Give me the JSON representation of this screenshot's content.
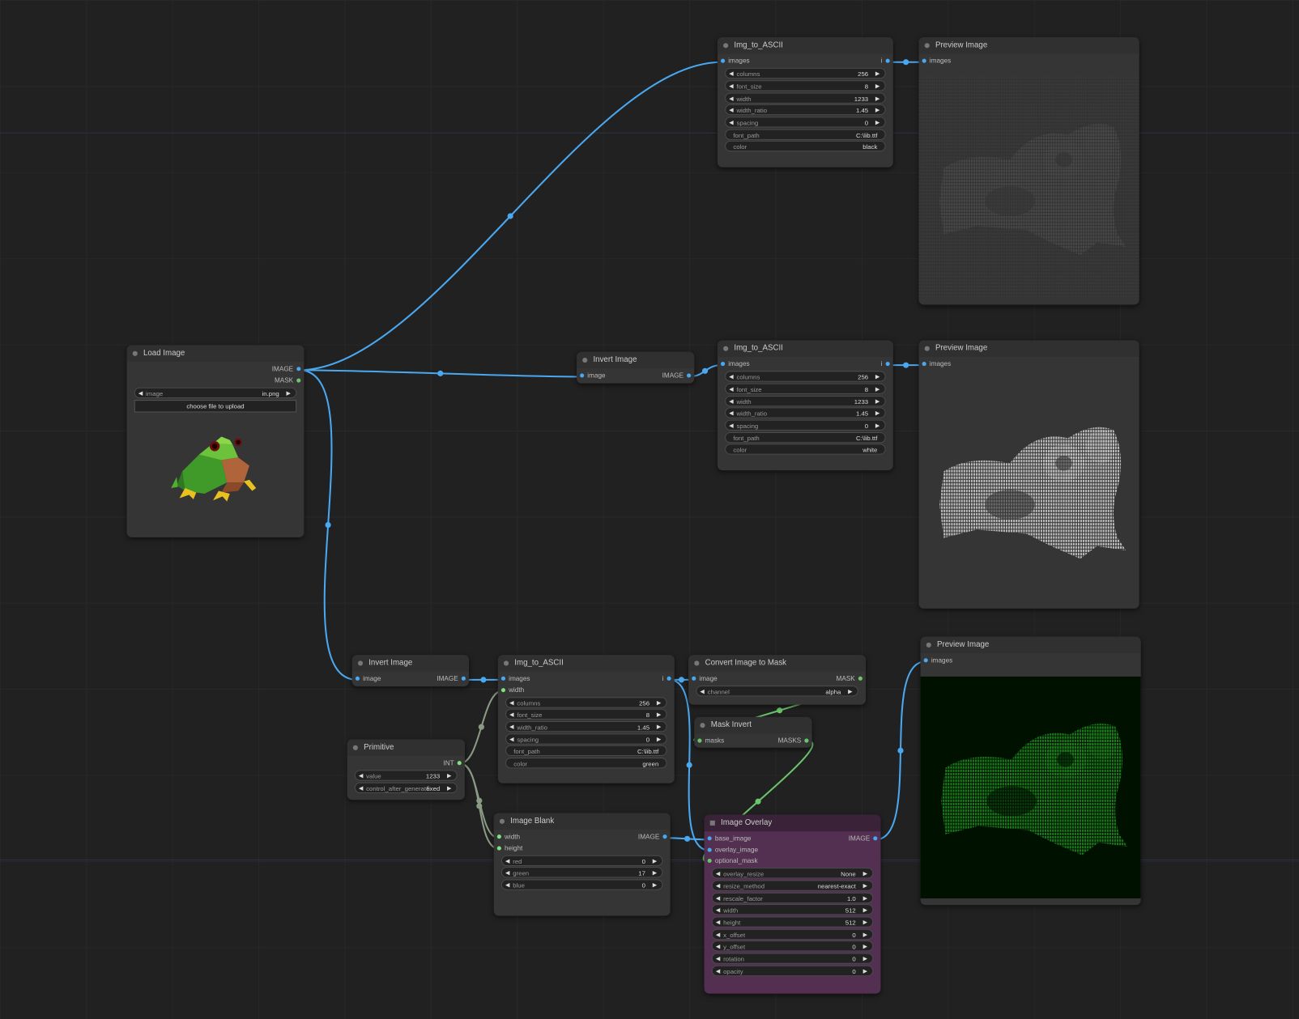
{
  "nodes": [
    {
      "id": "ascii1",
      "title": "Img_to_ASCII",
      "inputs": [
        {
          "label": "images",
          "color": "#4aa8f0"
        }
      ],
      "outputs": [
        {
          "label": "i",
          "color": "#4aa8f0"
        }
      ],
      "widgets": [
        {
          "label": "columns",
          "value": "256",
          "arrows": true
        },
        {
          "label": "font_size",
          "value": "8",
          "arrows": true
        },
        {
          "label": "width",
          "value": "1233",
          "arrows": true
        },
        {
          "label": "width_ratio",
          "value": "1.45",
          "arrows": true
        },
        {
          "label": "spacing",
          "value": "0",
          "arrows": true
        },
        {
          "label": "font_path",
          "value": "C:\\lib.ttf",
          "arrows": false
        },
        {
          "label": "color",
          "value": "black",
          "arrows": false
        }
      ]
    },
    {
      "id": "preview1",
      "title": "Preview Image",
      "inputs": [
        {
          "label": "images",
          "color": "#4aa8f0"
        }
      ],
      "outputs": [],
      "widgets": [],
      "preview": "black"
    },
    {
      "id": "load",
      "title": "Load Image",
      "inputs": [],
      "outputs": [
        {
          "label": "IMAGE",
          "color": "#4aa8f0"
        },
        {
          "label": "MASK",
          "color": "#6cc46c"
        }
      ],
      "widgets": [
        {
          "label": "image",
          "value": "in.png",
          "arrows": true
        }
      ],
      "button": "choose file to upload",
      "preview": "frog"
    },
    {
      "id": "invert1",
      "title": "Invert Image",
      "inputs": [
        {
          "label": "image",
          "color": "#4aa8f0"
        }
      ],
      "outputs": [
        {
          "label": "IMAGE",
          "color": "#4aa8f0"
        }
      ],
      "widgets": []
    },
    {
      "id": "ascii2",
      "title": "Img_to_ASCII",
      "inputs": [
        {
          "label": "images",
          "color": "#4aa8f0"
        }
      ],
      "outputs": [
        {
          "label": "i",
          "color": "#4aa8f0"
        }
      ],
      "widgets": [
        {
          "label": "columns",
          "value": "256",
          "arrows": true
        },
        {
          "label": "font_size",
          "value": "8",
          "arrows": true
        },
        {
          "label": "width",
          "value": "1233",
          "arrows": true
        },
        {
          "label": "width_ratio",
          "value": "1.45",
          "arrows": true
        },
        {
          "label": "spacing",
          "value": "0",
          "arrows": true
        },
        {
          "label": "font_path",
          "value": "C:\\lib.ttf",
          "arrows": false
        },
        {
          "label": "color",
          "value": "white",
          "arrows": false
        }
      ]
    },
    {
      "id": "preview2",
      "title": "Preview Image",
      "inputs": [
        {
          "label": "images",
          "color": "#4aa8f0"
        }
      ],
      "outputs": [],
      "widgets": [],
      "preview": "white"
    },
    {
      "id": "invert2",
      "title": "Invert Image",
      "inputs": [
        {
          "label": "image",
          "color": "#4aa8f0"
        }
      ],
      "outputs": [
        {
          "label": "IMAGE",
          "color": "#4aa8f0"
        }
      ],
      "widgets": []
    },
    {
      "id": "ascii3",
      "title": "Img_to_ASCII",
      "inputs": [
        {
          "label": "images",
          "color": "#4aa8f0"
        },
        {
          "label": "width",
          "color": "#7ee07e"
        }
      ],
      "outputs": [
        {
          "label": "i",
          "color": "#4aa8f0"
        }
      ],
      "widgets": [
        {
          "label": "columns",
          "value": "256",
          "arrows": true
        },
        {
          "label": "font_size",
          "value": "8",
          "arrows": true
        },
        {
          "label": "width_ratio",
          "value": "1.45",
          "arrows": true
        },
        {
          "label": "spacing",
          "value": "0",
          "arrows": true
        },
        {
          "label": "font_path",
          "value": "C:\\lib.ttf",
          "arrows": false
        },
        {
          "label": "color",
          "value": "green",
          "arrows": false
        }
      ]
    },
    {
      "id": "convmask",
      "title": "Convert Image to Mask",
      "inputs": [
        {
          "label": "image",
          "color": "#4aa8f0"
        }
      ],
      "outputs": [
        {
          "label": "MASK",
          "color": "#6cc46c"
        }
      ],
      "widgets": [
        {
          "label": "channel",
          "value": "alpha",
          "arrows": true
        }
      ]
    },
    {
      "id": "maskinv",
      "title": "Mask Invert",
      "inputs": [
        {
          "label": "masks",
          "color": "#6cc46c"
        }
      ],
      "outputs": [
        {
          "label": "MASKS",
          "color": "#6cc46c"
        }
      ],
      "widgets": []
    },
    {
      "id": "primitive",
      "title": "Primitive",
      "inputs": [],
      "outputs": [
        {
          "label": "INT",
          "color": "#7ee07e"
        }
      ],
      "widgets": [
        {
          "label": "value",
          "value": "1233",
          "arrows": true
        },
        {
          "label": "control_after_generate",
          "value": "fixed",
          "arrows": true
        }
      ]
    },
    {
      "id": "blank",
      "title": "Image Blank",
      "inputs": [
        {
          "label": "width",
          "color": "#7ee07e"
        },
        {
          "label": "height",
          "color": "#7ee07e"
        }
      ],
      "outputs": [
        {
          "label": "IMAGE",
          "color": "#4aa8f0"
        }
      ],
      "widgets": [
        {
          "label": "red",
          "value": "0",
          "arrows": true
        },
        {
          "label": "green",
          "value": "17",
          "arrows": true
        },
        {
          "label": "blue",
          "value": "0",
          "arrows": true
        }
      ]
    },
    {
      "id": "overlay",
      "title": "Image Overlay",
      "inputs": [
        {
          "label": "base_image",
          "color": "#4aa8f0"
        },
        {
          "label": "overlay_image",
          "color": "#4aa8f0"
        },
        {
          "label": "optional_mask",
          "color": "#6cc46c"
        }
      ],
      "outputs": [
        {
          "label": "IMAGE",
          "color": "#4aa8f0"
        }
      ],
      "widgets": [
        {
          "label": "overlay_resize",
          "value": "None",
          "arrows": true
        },
        {
          "label": "resize_method",
          "value": "nearest-exact",
          "arrows": true
        },
        {
          "label": "rescale_factor",
          "value": "1.0",
          "arrows": true
        },
        {
          "label": "width",
          "value": "512",
          "arrows": true
        },
        {
          "label": "height",
          "value": "512",
          "arrows": true
        },
        {
          "label": "x_offset",
          "value": "0",
          "arrows": true
        },
        {
          "label": "y_offset",
          "value": "0",
          "arrows": true
        },
        {
          "label": "rotation",
          "value": "0",
          "arrows": true
        },
        {
          "label": "opacity",
          "value": "0",
          "arrows": true
        }
      ]
    },
    {
      "id": "preview3",
      "title": "Preview Image",
      "inputs": [
        {
          "label": "images",
          "color": "#4aa8f0"
        }
      ],
      "outputs": [],
      "widgets": [],
      "preview": "green"
    }
  ],
  "colors": {
    "image_link": "#4aa8f0",
    "mask_link": "#6cc46c",
    "int_link": "#8a9a84",
    "overlay_node": "#532f51"
  }
}
